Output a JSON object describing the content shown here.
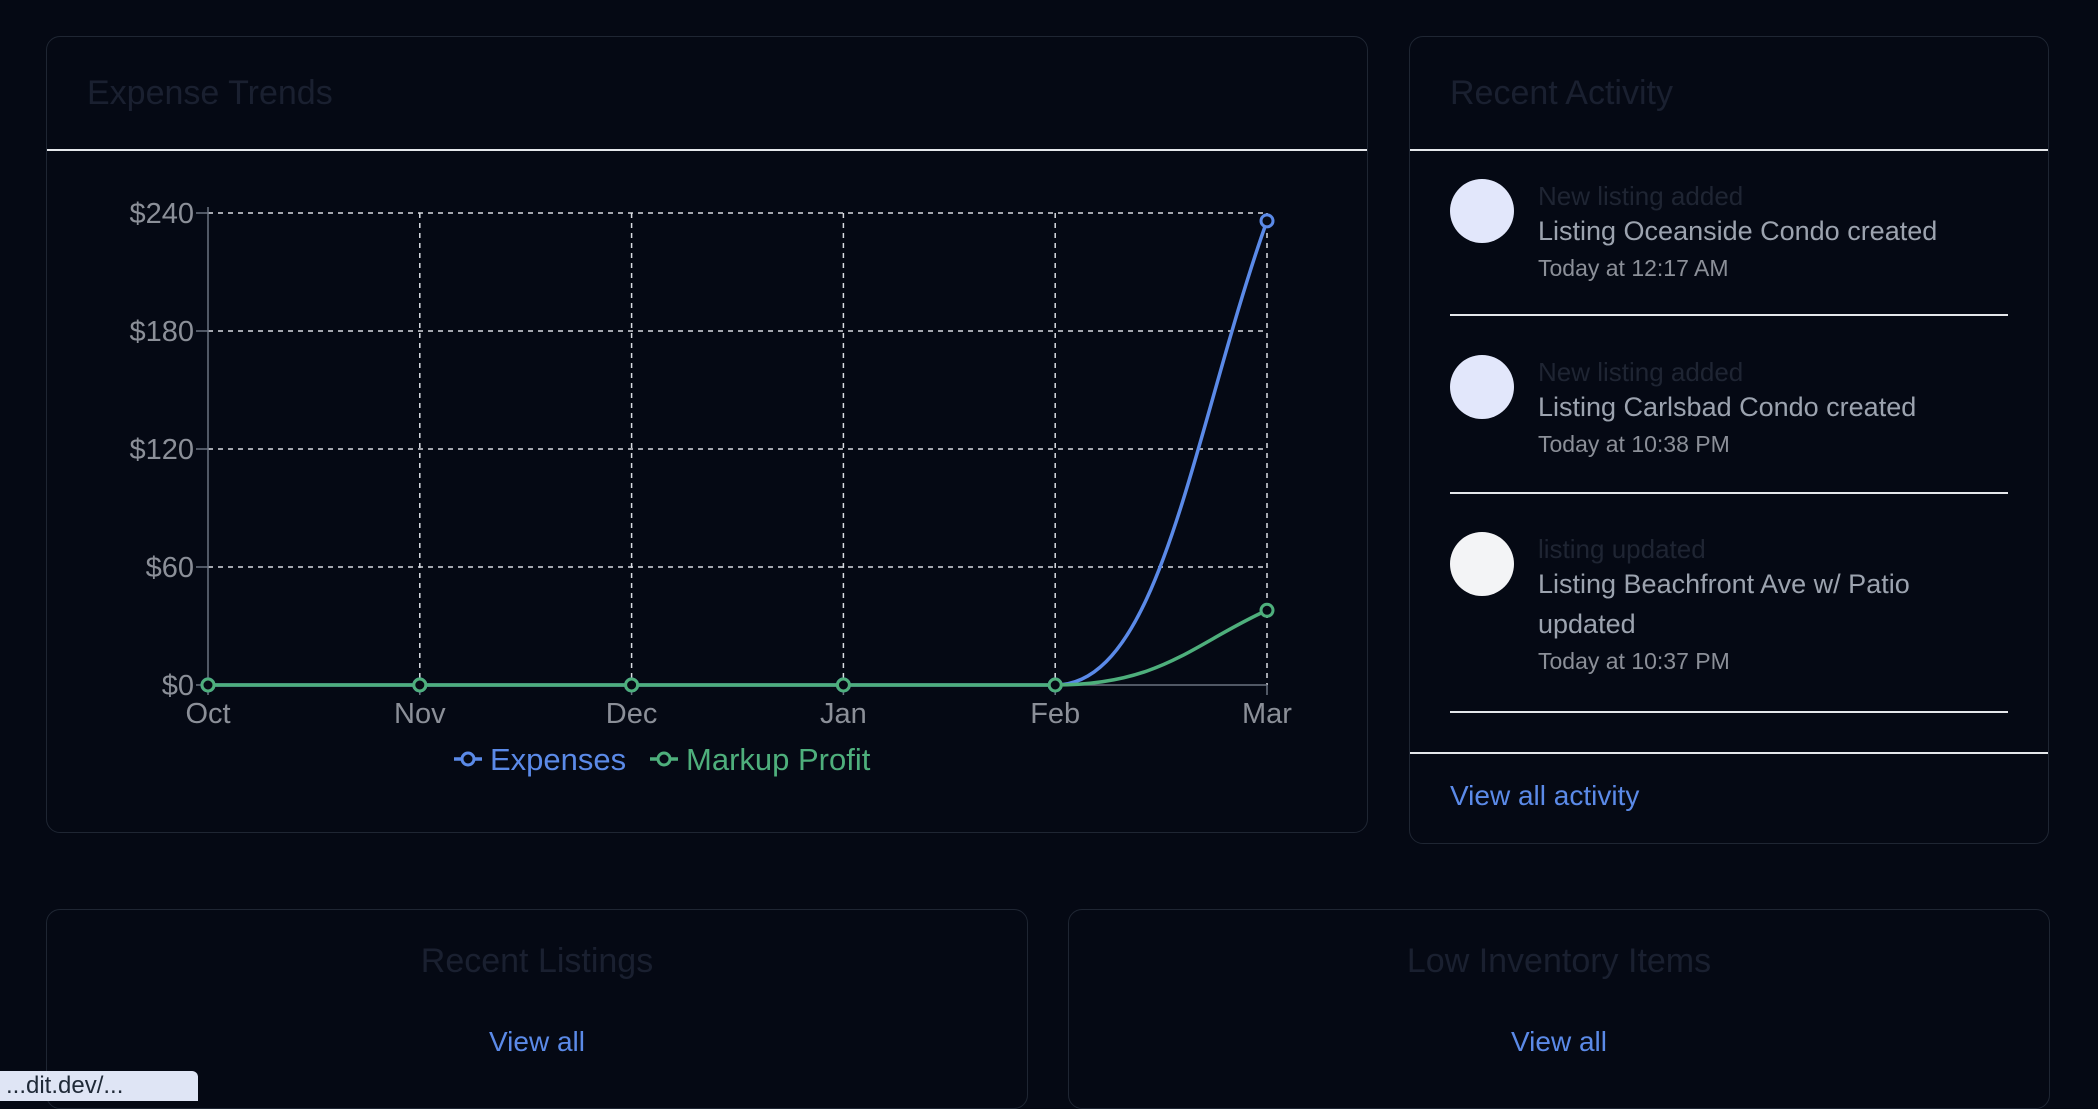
{
  "expense_trends": {
    "title": "Expense Trends",
    "chart_data": {
      "type": "line",
      "categories": [
        "Oct",
        "Nov",
        "Dec",
        "Jan",
        "Feb",
        "Mar"
      ],
      "y_ticks": [
        "$0",
        "$60",
        "$120",
        "$180",
        "$240"
      ],
      "ylim": [
        0,
        240
      ],
      "grid": true,
      "legend_position": "bottom",
      "series": [
        {
          "name": "Expenses",
          "color": "#5b8ae8",
          "values": [
            0,
            0,
            0,
            0,
            0,
            236
          ]
        },
        {
          "name": "Markup Profit",
          "color": "#4eaf7c",
          "values": [
            0,
            0,
            0,
            0,
            0,
            38
          ]
        }
      ]
    }
  },
  "recent_activity": {
    "title": "Recent Activity",
    "items": [
      {
        "type": "New listing added",
        "description": "Listing Oceanside Condo created",
        "time": "Today at 12:17 AM",
        "avatar_color": "#e2e7fb"
      },
      {
        "type": "New listing added",
        "description": "Listing Carlsbad Condo created",
        "time": "Today at 10:38 PM",
        "avatar_color": "#e2e7fb"
      },
      {
        "type": "listing updated",
        "description": "Listing Beachfront Ave w/ Patio updated",
        "time": "Today at 10:37 PM",
        "avatar_color": "#f3f4f6"
      }
    ],
    "view_all_label": "View all activity"
  },
  "recent_listings": {
    "title": "Recent Listings",
    "view_all_label": "View all"
  },
  "low_inventory": {
    "title": "Low Inventory Items",
    "view_all_label": "View all"
  },
  "status_bar": {
    "url": "...dit.dev/..."
  }
}
